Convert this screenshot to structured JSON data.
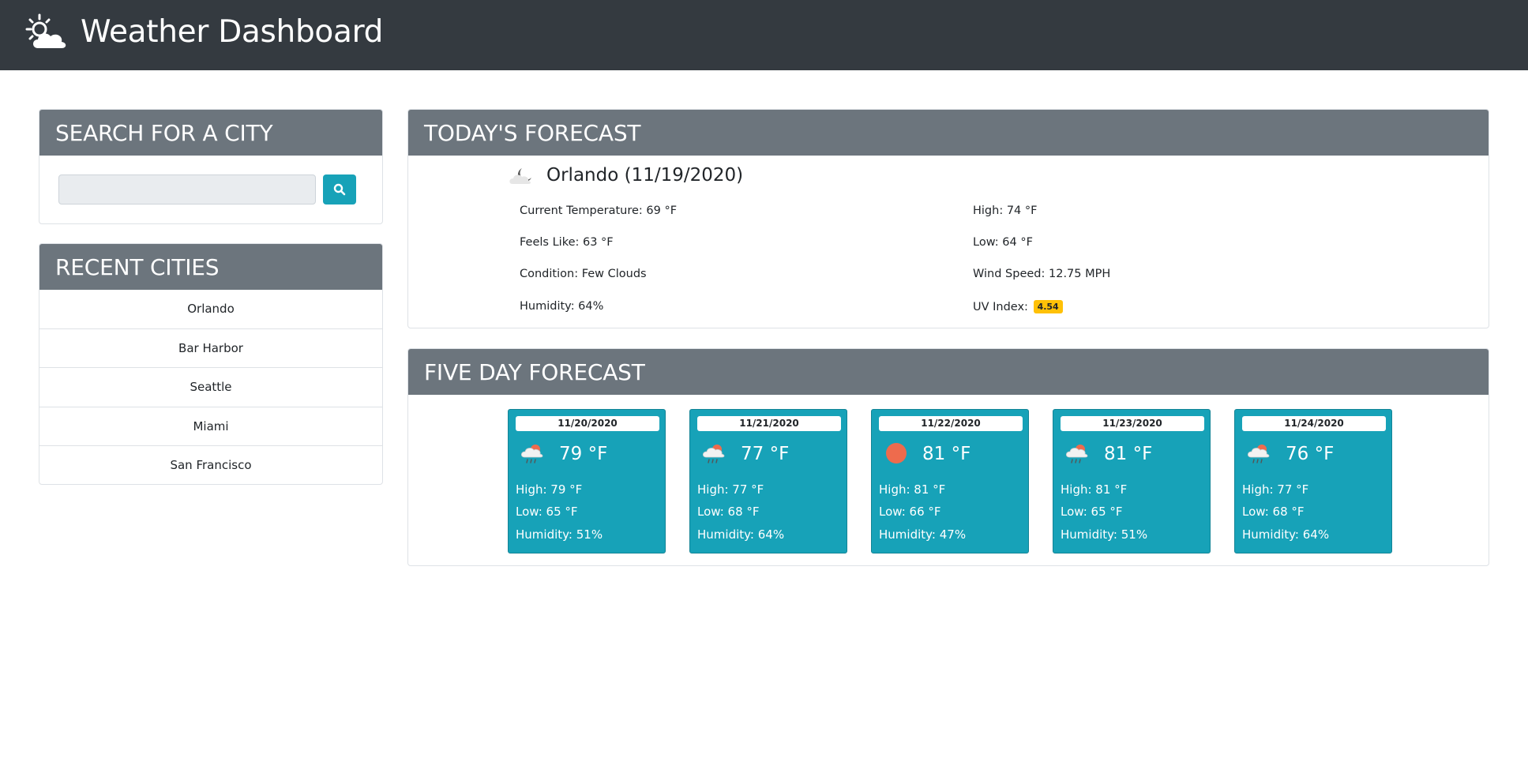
{
  "header": {
    "title": "Weather Dashboard",
    "logo_icon": "sun-cloud-icon"
  },
  "search": {
    "heading": "SEARCH FOR A CITY",
    "value": "",
    "placeholder": "",
    "button_icon": "search-icon"
  },
  "recent": {
    "heading": "RECENT CITIES",
    "cities": [
      "Orlando",
      "Bar Harbor",
      "Seattle",
      "Miami",
      "San Francisco"
    ]
  },
  "today": {
    "heading": "TODAY'S FORECAST",
    "city_line": "Orlando (11/19/2020)",
    "icon": "few-clouds-night-icon",
    "current_temperature": "Current Temperature: 69 °F",
    "feels_like": "Feels Like: 63 °F",
    "condition": "Condition: Few Clouds",
    "humidity": "Humidity: 64%",
    "high": "High: 74 °F",
    "low": "Low: 64 °F",
    "wind_speed": "Wind Speed: 12.75 MPH",
    "uv_label": "UV Index:",
    "uv_value": "4.54",
    "uv_color": "#ffc107"
  },
  "five_day": {
    "heading": "FIVE DAY FORECAST",
    "days": [
      {
        "date": "11/20/2020",
        "icon": "rain-sun-icon",
        "temp": "79 °F",
        "high": "High: 79 °F",
        "low": "Low: 65 °F",
        "humidity": "Humidity: 51%"
      },
      {
        "date": "11/21/2020",
        "icon": "rain-sun-icon",
        "temp": "77 °F",
        "high": "High: 77 °F",
        "low": "Low: 68 °F",
        "humidity": "Humidity: 64%"
      },
      {
        "date": "11/22/2020",
        "icon": "sun-icon",
        "temp": "81 °F",
        "high": "High: 81 °F",
        "low": "Low: 66 °F",
        "humidity": "Humidity: 47%"
      },
      {
        "date": "11/23/2020",
        "icon": "rain-sun-icon",
        "temp": "81 °F",
        "high": "High: 81 °F",
        "low": "Low: 65 °F",
        "humidity": "Humidity: 51%"
      },
      {
        "date": "11/24/2020",
        "icon": "rain-sun-icon",
        "temp": "76 °F",
        "high": "High: 77 °F",
        "low": "Low: 68 °F",
        "humidity": "Humidity: 64%"
      }
    ]
  },
  "colors": {
    "navbar": "#343a40",
    "card_header": "#6c757d",
    "accent": "#17a2b8",
    "sun": "#ee6b4d"
  }
}
